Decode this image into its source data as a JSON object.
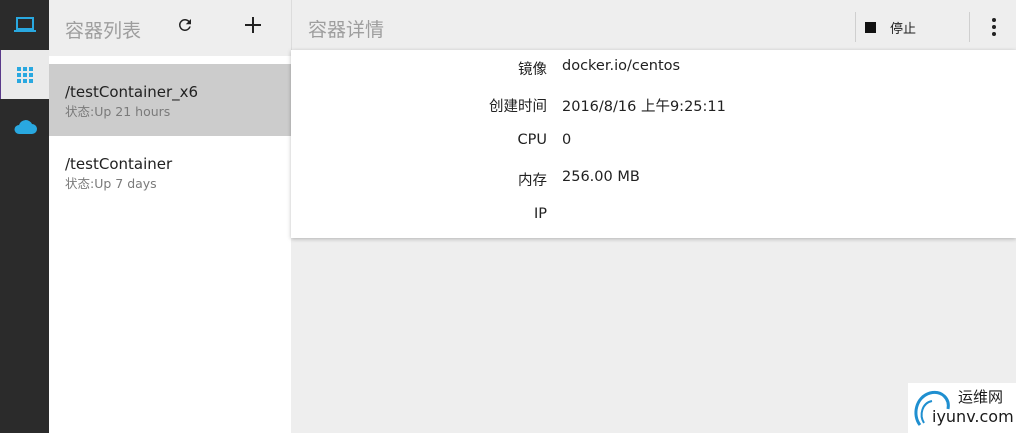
{
  "rail": {
    "items": [
      {
        "icon": "laptop-icon",
        "active": false
      },
      {
        "icon": "apps-grid-icon",
        "active": true
      },
      {
        "icon": "cloud-icon",
        "active": false
      }
    ],
    "accent": "#29a8e0"
  },
  "list": {
    "title": "容器列表",
    "refresh_icon": "refresh-icon",
    "add_icon": "add-icon",
    "items": [
      {
        "name": "/testContainer_x6",
        "status": "状态:Up 21 hours",
        "selected": true
      },
      {
        "name": "/testContainer",
        "status": "状态:Up 7 days",
        "selected": false
      }
    ]
  },
  "detail": {
    "title": "容器详情",
    "stop_label": "停止",
    "more_icon": "more-vert-icon",
    "fields": [
      {
        "label": "镜像",
        "value": "docker.io/centos"
      },
      {
        "label": "创建时间",
        "value": "2016/8/16 上午9:25:11"
      },
      {
        "label": "CPU",
        "value": "0"
      },
      {
        "label": "内存",
        "value": "256.00 MB"
      },
      {
        "label": "IP",
        "value": ""
      }
    ]
  },
  "watermark": {
    "top_text": "运维网",
    "bottom_text": "iyunv.com"
  }
}
